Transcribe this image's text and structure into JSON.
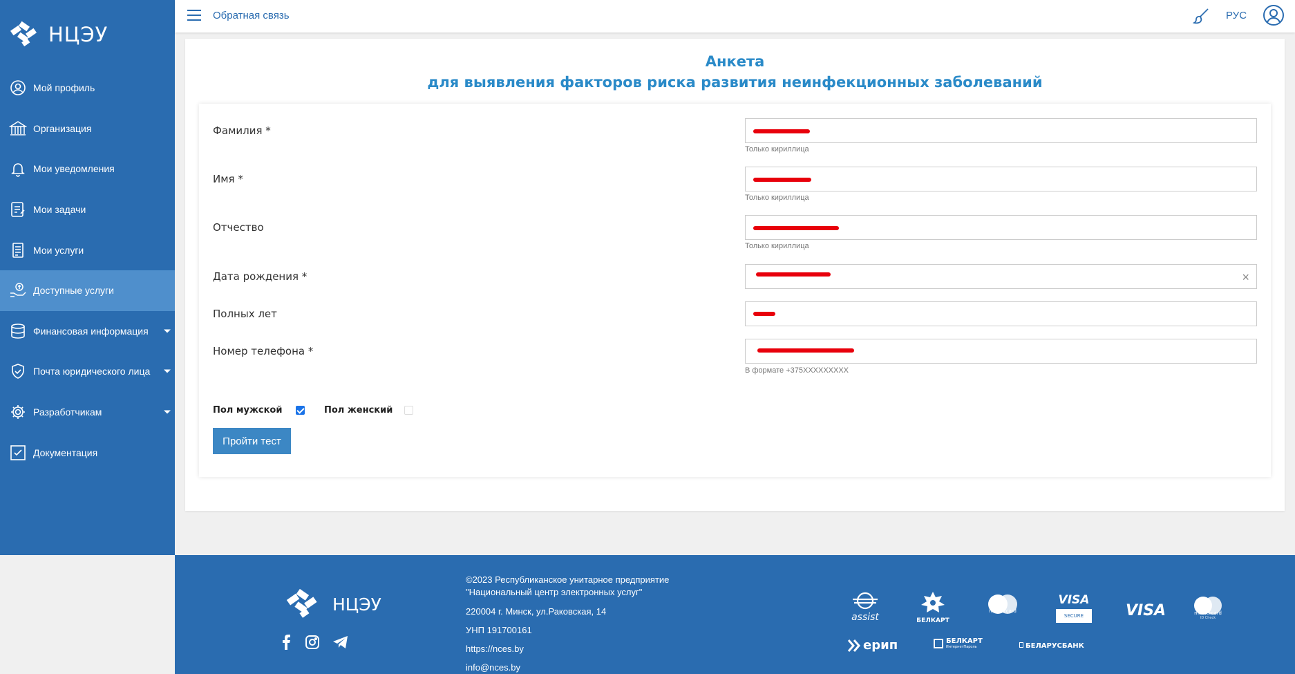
{
  "app": {
    "logo_text": "НЦЭУ"
  },
  "sidebar": {
    "items": [
      {
        "label": "Мой профиль",
        "icon": "user-circle-icon"
      },
      {
        "label": "Организация",
        "icon": "building-icon"
      },
      {
        "label": "Мои уведомления",
        "icon": "bell-icon"
      },
      {
        "label": "Мои задачи",
        "icon": "tasks-icon"
      },
      {
        "label": "Мои услуги",
        "icon": "services-icon"
      },
      {
        "label": "Доступные услуги",
        "icon": "hand-service-icon"
      },
      {
        "label": "Финансовая информация",
        "icon": "database-icon"
      },
      {
        "label": "Почта юридического лица",
        "icon": "shield-icon"
      },
      {
        "label": "Разработчикам",
        "icon": "gear-icon"
      },
      {
        "label": "Документация",
        "icon": "checkbox-icon"
      }
    ]
  },
  "topbar": {
    "feedback": "Обратная связь",
    "lang": "РУС"
  },
  "form": {
    "title_line1": "Анкета",
    "title_line2": "для выявления факторов риска развития неинфекционных заболеваний",
    "fields": {
      "surname": {
        "label": "Фамилия *",
        "value": "",
        "hint": "Только кириллица"
      },
      "name": {
        "label": "Имя *",
        "value": "",
        "hint": "Только кириллица"
      },
      "patronymic": {
        "label": "Отчество",
        "value": "",
        "hint": "Только кириллица"
      },
      "birthdate": {
        "label": "Дата рождения *",
        "value": ""
      },
      "age": {
        "label": "Полных лет",
        "value": ""
      },
      "phone": {
        "label": "Номер телефона *",
        "value": "",
        "hint": "В формате +375XXXXXXXXX"
      }
    },
    "gender_male": {
      "label": "Пол мужской",
      "checked": true
    },
    "gender_female": {
      "label": "Пол женский",
      "checked": false
    },
    "submit": "Пройти тест"
  },
  "footer": {
    "logo_text": "НЦЭУ",
    "line1": "©2023 Республиканское унитарное предприятие",
    "line2": "\"Национальный центр электронных услуг\"",
    "address": "220004 г. Минск, ул.Раковская, 14",
    "unp": "УНП 191700161",
    "site": "https://nces.by",
    "email": "info@nces.by",
    "payments": {
      "assist": "assist",
      "belkart": "БЕЛКАРТ",
      "mastercard": "mastercard",
      "visa_secure_top": "VISA",
      "visa_secure_bottom": "SECURE",
      "visa": "VISA",
      "mastercard_id": "mastercard",
      "mastercard_id_sub": "ID Check",
      "erip": "ерип",
      "belkart_ip": "БЕЛКАРТ",
      "belkart_ip_sub": "ИнтернетПароль",
      "belarusbank": "БЕЛАРУСБАНК"
    }
  }
}
